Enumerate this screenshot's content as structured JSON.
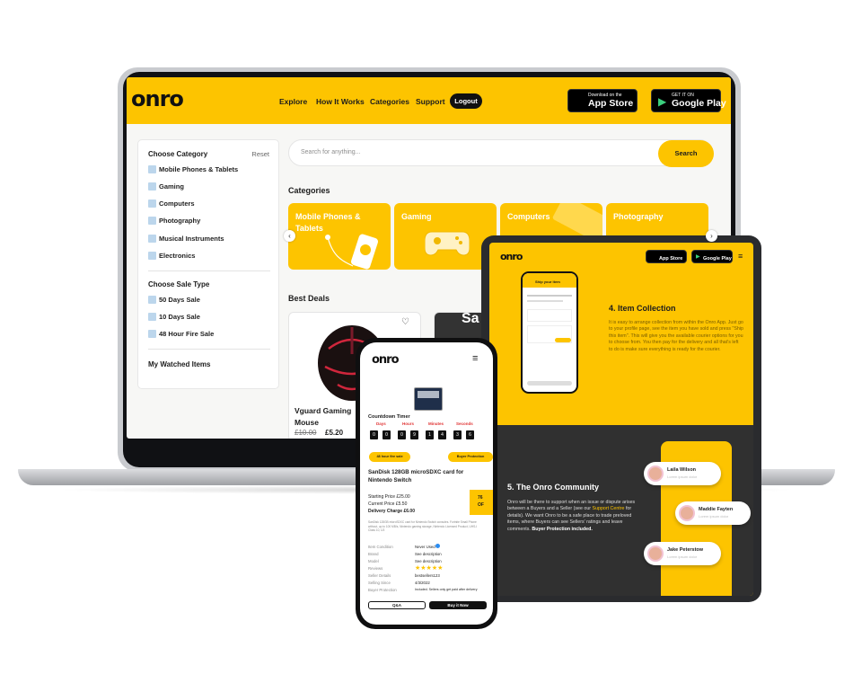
{
  "laptop": {
    "logo": "onro",
    "nav": [
      "Explore",
      "How It Works",
      "Categories",
      "Support"
    ],
    "logout": "Logout",
    "app_store": {
      "small": "Download on the",
      "big": "App Store"
    },
    "google_play": {
      "small": "GET IT ON",
      "big": "Google Play"
    },
    "sidebar": {
      "category_title": "Choose Category",
      "reset": "Reset",
      "categories": [
        "Mobile Phones & Tablets",
        "Gaming",
        "Computers",
        "Photography",
        "Musical Instruments",
        "Electronics"
      ],
      "sale_title": "Choose Sale Type",
      "sale_types": [
        "50 Days Sale",
        "10 Days Sale",
        "48 Hour Fire Sale"
      ],
      "watched": "My Watched Items"
    },
    "search": {
      "placeholder": "Search for anything...",
      "button": "Search"
    },
    "categories_title": "Categories",
    "category_cards": [
      "Mobile Phones & Tablets",
      "Gaming",
      "Computers",
      "Photography"
    ],
    "best_deals_title": "Best Deals",
    "deal": {
      "name": "Vguard Gaming Mouse",
      "old_price": "£10.00",
      "price": "£5.20"
    },
    "deal2_partial": "Sa"
  },
  "tablet": {
    "logo": "onro",
    "item_collection_title": "4. Item Collection",
    "item_collection_text": "It is easy to arrange collection from within the Onro App. Just go to your profile page, see the item you have sold and press \"Ship this item\". This will give you the available courier options for you to choose from. You then pay for the delivery and all that's left to do is make sure everything is ready for the courier.",
    "phone_screen_title": "Ship your item",
    "community_title": "5. The Onro Community",
    "community_text_1": "Onro will be there to support when an issue or dispute arises between a Buyers and a Seller (see our",
    "community_link": "Support Centre",
    "community_text_2": "for details). We want Onro to be a safe place to trade preloved items, where Buyers can see Sellers' ratings and leave comments.",
    "community_bold": "Buyer Protection included.",
    "users": [
      {
        "name": "Laila Wilson",
        "sub": "Lorem ipsum dolor"
      },
      {
        "name": "Maddie Fayten",
        "sub": "Lorem ipsum dolor"
      },
      {
        "name": "Jake Peterstow",
        "sub": "Lorem ipsum dolor"
      }
    ]
  },
  "phone": {
    "logo": "onro",
    "countdown_label": "Countdown Timer",
    "units": [
      "Days",
      "Hours",
      "Minutes",
      "Seconds"
    ],
    "digits": [
      "0",
      "0",
      "0",
      "9",
      "1",
      "4",
      "3",
      "6"
    ],
    "pill_left": "48 hour fire sale",
    "pill_right": "Buyer Protection",
    "title": "SanDisk 128GB microSDXC card for Nintendo Switch",
    "starting_price": "Starting Price £25.00",
    "current_price": "Current Price £5.50",
    "delivery": "Delivery Charge £6.00",
    "badge_top": "76",
    "badge_bottom": "OF",
    "desc": "SanDisk 128GB microSDXC card for Nintendo Switch consoles. Fortnite Small Phone without, up to 100 MB/s, Nintendo gaming storage, Nintendo Licensed Product, UHS-I Class 10, U3",
    "details": [
      {
        "label": "Item Condition",
        "value": "Never Used"
      },
      {
        "label": "Brand",
        "value": "See description"
      },
      {
        "label": "Model",
        "value": "See description"
      },
      {
        "label": "Reviews",
        "value": "★★★★★"
      },
      {
        "label": "Seller Details",
        "value": "bestsellers123"
      },
      {
        "label": "Selling Since",
        "value": "4/3/2022"
      },
      {
        "label": "Buyer Protection",
        "value": "Included. Sellers only get paid after delivery"
      }
    ],
    "qa_button": "Q&A",
    "buy_button": "Buy it Now"
  },
  "colors": {
    "brand_yellow": "#fdc400",
    "dark": "#303030",
    "link_yellow": "#fdc400"
  }
}
